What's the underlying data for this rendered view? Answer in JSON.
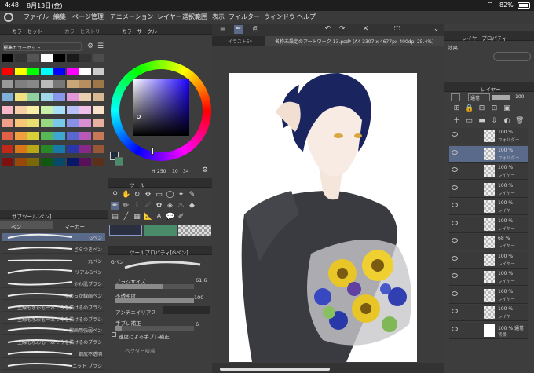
{
  "status": {
    "time": "4:48",
    "date": "8月13日(金)",
    "battery": "82%"
  },
  "menu": [
    "ファイル",
    "編集",
    "ページ管理",
    "アニメーション",
    "レイヤー",
    "選択範囲",
    "表示",
    "フィルター",
    "ウィンドウ",
    "ヘルプ"
  ],
  "colorset": {
    "tabs": [
      "カラーセット",
      "カラーヒストリー"
    ],
    "set_name": "標準カラーセット",
    "colors": [
      "#000000",
      "#333333",
      "#555555",
      "#ffffff",
      "#000000",
      "#1a1a1a",
      "#333333",
      "#4d4d4d",
      "#ff0000",
      "#ffff00",
      "#00ff00",
      "#00ffff",
      "#0000ff",
      "#ff00ff",
      "#ffffff",
      "#cccccc",
      "#999999",
      "#7f7f7f",
      "#888888",
      "#bbbbbb",
      "#777777",
      "#c8a878",
      "#b89060",
      "#9c7848",
      "#7fb0d8",
      "#f0e080",
      "#90d0a0",
      "#a0d8e8",
      "#8898e8",
      "#e098d8",
      "#e8d0b0",
      "#d8b890",
      "#f8b8c8",
      "#f8d0a8",
      "#f8f0a8",
      "#c8f0a8",
      "#a8e0f8",
      "#b8c0f8",
      "#f0c0e8",
      "#f8e0c8",
      "#f0a088",
      "#f8c878",
      "#e8e070",
      "#98d880",
      "#78c8e8",
      "#8890e8",
      "#d890d0",
      "#e8b0a0",
      "#e06048",
      "#f0a040",
      "#d8d038",
      "#58b858",
      "#40a8d0",
      "#5868d0",
      "#b858b8",
      "#c87858",
      "#c02818",
      "#d87818",
      "#b8a818",
      "#288828",
      "#1878a8",
      "#2838a8",
      "#882888",
      "#985838",
      "#801010",
      "#984808",
      "#786808",
      "#105810",
      "#084868",
      "#081868",
      "#581058",
      "#5c3018"
    ]
  },
  "colorcircle": {
    "tab": "カラーサークル",
    "h": "250",
    "s": "10",
    "v": "34",
    "hue_label": "H"
  },
  "tool_panel": {
    "tab": "ツール"
  },
  "subtool": {
    "tabs": [
      "サブツール[ペン]"
    ],
    "groups": [
      "ペン",
      "マーカー"
    ],
    "brushes": [
      "Gペン",
      "ざらつきペン",
      "丸ペン",
      "リアルGペン",
      "やわ肌ブラシ",
      "なめらか線画ペン",
      "主線も水彩も一本で今を描けるのブラシ",
      "主線も水彩も一本で今を描けるのブラシ",
      "線画用強弱ペン",
      "主線も水彩も一本で今を描けるのブラシ",
      "鋼尻不透明",
      "ニット ブラシ"
    ]
  },
  "toolprop": {
    "tab": "ツールプロパティ[Gペン]",
    "brush": "Gペン",
    "size_label": "ブラシサイズ",
    "size_value": "61.6",
    "opacity_label": "不透明度",
    "opacity_value": "100",
    "aa_label": "アンチエイリアス",
    "stab_label": "手ブレ補正",
    "stab_value": "6",
    "speed_label": "速度による手ブレ補正",
    "vector_label": "ベクター吸着"
  },
  "canvas_tabs": [
    "イラスト5*",
    "名称未設定のアートワーク-13.psd* (A4 3307 x 4677px 400dpi 25.4%)"
  ],
  "layerprop": {
    "tab": "レイヤープロパティ",
    "effect_label": "効果"
  },
  "layers": {
    "tab": "レイヤー",
    "blend": "通常",
    "opacity": "100",
    "rows": [
      {
        "pct": "100 %",
        "name": "フォルダー"
      },
      {
        "pct": "100 %",
        "name": "フォルダー"
      },
      {
        "pct": "100 %",
        "name": "レイヤー"
      },
      {
        "pct": "100 %",
        "name": "レイヤー"
      },
      {
        "pct": "100 %",
        "name": "レイヤー"
      },
      {
        "pct": "100 %",
        "name": "レイヤー"
      },
      {
        "pct": "68 %",
        "name": "レイヤー"
      },
      {
        "pct": "100 %",
        "name": "レイヤー"
      },
      {
        "pct": "100 %",
        "name": "レイヤー"
      },
      {
        "pct": "100 %",
        "name": "レイヤー"
      },
      {
        "pct": "100 %",
        "name": "レイヤー"
      },
      {
        "pct": "100 % 通常",
        "name": "背景"
      }
    ]
  }
}
